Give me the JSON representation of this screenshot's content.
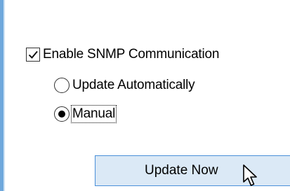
{
  "snmp": {
    "enable_label": "Enable SNMP Communication",
    "enable_checked": true,
    "update_auto_label": "Update Automatically",
    "manual_label": "Manual",
    "selected_option": "Manual"
  },
  "update_button": {
    "label": "Update Now"
  },
  "icons": {
    "cursor": "mouse-pointer-icon",
    "checkbox": "checkmark-icon"
  },
  "colors": {
    "button_bg": "#dbe9f6",
    "button_border": "#4a90d9",
    "panel_border": "#6fa8dc"
  }
}
